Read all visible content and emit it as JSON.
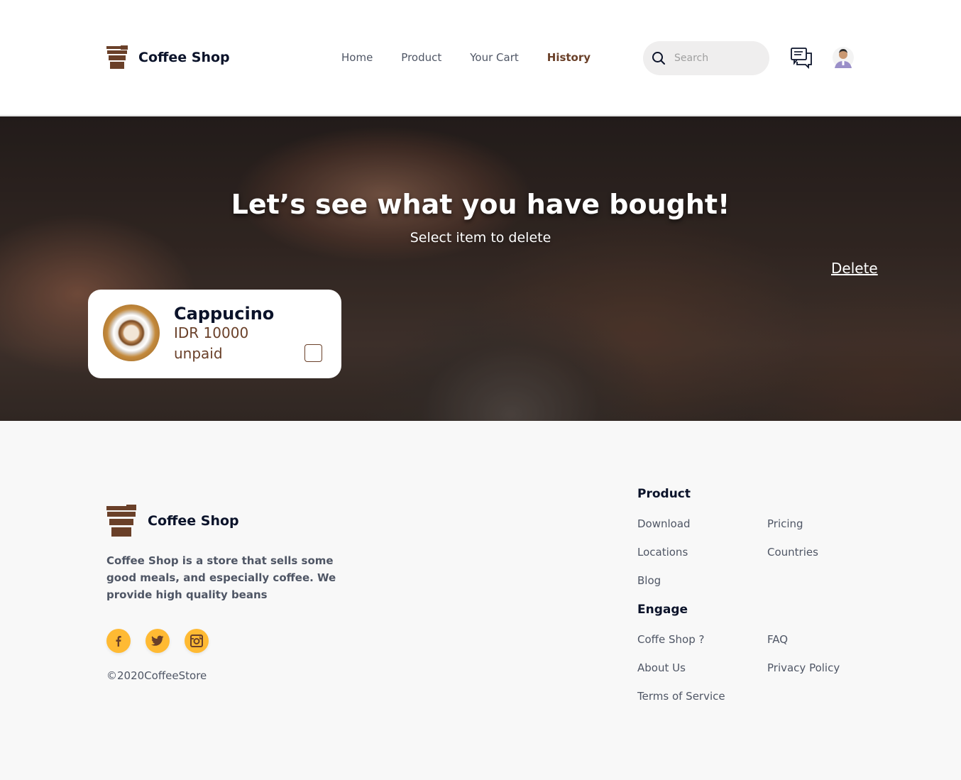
{
  "header": {
    "brand": "Coffee Shop",
    "nav": [
      {
        "label": "Home"
      },
      {
        "label": "Product"
      },
      {
        "label": "Your Cart"
      },
      {
        "label": "History"
      }
    ],
    "active_nav": "History",
    "search_placeholder": "Search"
  },
  "hero": {
    "title": "Let’s see what you have bought!",
    "subtitle": "Select item to delete",
    "delete_label": "Delete"
  },
  "history_items": [
    {
      "name": "Cappucino",
      "price": "IDR 10000",
      "status": "unpaid",
      "selected": false
    }
  ],
  "footer": {
    "brand": "Coffee Shop",
    "description": "Coffee Shop is a store that sells some good meals, and especially coffee. We provide high quality beans",
    "socials": [
      "facebook-icon",
      "twitter-icon",
      "instagram-icon"
    ],
    "copyright": "©2020CoffeeStore",
    "product_heading": "Product",
    "product_links": [
      "Download",
      "Pricing",
      "Locations",
      "Countries",
      "Blog"
    ],
    "engage_heading": "Engage",
    "engage_links": [
      "Coffe Shop ?",
      "FAQ",
      "About Us",
      "Privacy Policy",
      "Terms of Service"
    ]
  },
  "colors": {
    "brand_brown": "#6a4029",
    "accent_yellow": "#ffba33",
    "text_dark": "#0b132a",
    "text_muted": "#4f5665"
  }
}
